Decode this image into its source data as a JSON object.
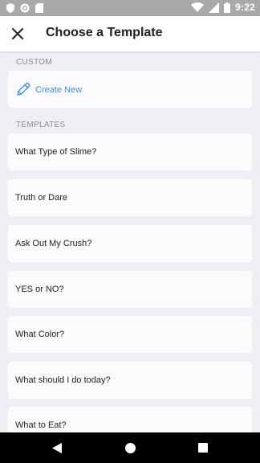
{
  "status_bar": {
    "time": "9:22",
    "left_icons": [
      "shield-icon",
      "record-icon",
      "sd-card-icon"
    ],
    "right_icons": [
      "wifi-icon",
      "signal-icon",
      "battery-icon"
    ]
  },
  "app_bar": {
    "title": "Choose a Template",
    "close_icon": "close-icon"
  },
  "custom_section": {
    "header": "CUSTOM",
    "create_label": "Create New",
    "create_icon": "pencil-icon",
    "accent_color": "#3d8fe0"
  },
  "templates_section": {
    "header": "TEMPLATES",
    "items": [
      {
        "label": "What Type of Slime?"
      },
      {
        "label": "Truth or Dare"
      },
      {
        "label": "Ask Out My Crush?"
      },
      {
        "label": "YES or NO?"
      },
      {
        "label": "What Color?"
      },
      {
        "label": "What should I do today?"
      },
      {
        "label": "What to Eat?"
      }
    ]
  },
  "nav_bar": {
    "buttons": [
      "back-icon",
      "home-icon",
      "recents-icon"
    ]
  }
}
